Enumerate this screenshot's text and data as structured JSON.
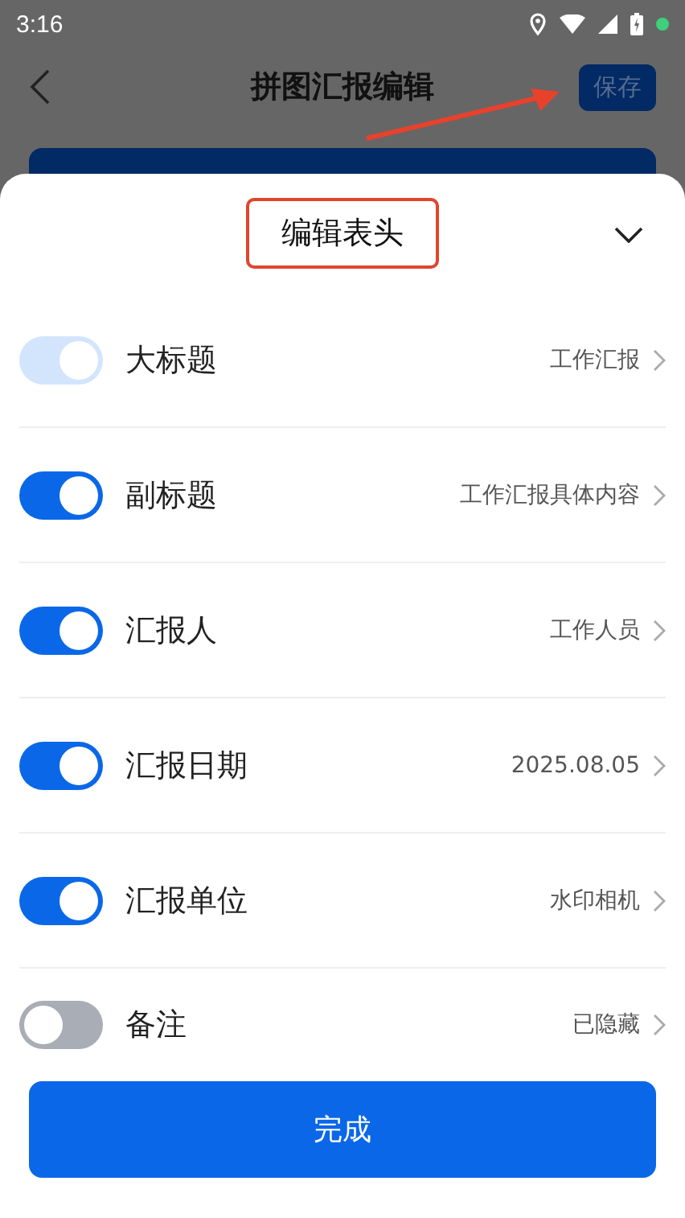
{
  "status_bar": {
    "time": "3:16"
  },
  "header": {
    "title": "拼图汇报编辑",
    "save_button": "保存"
  },
  "sheet": {
    "title": "编辑表头",
    "items": [
      {
        "label": "大标题",
        "value": "工作汇报",
        "on": true,
        "disabled": true
      },
      {
        "label": "副标题",
        "value": "工作汇报具体内容",
        "on": true,
        "disabled": false
      },
      {
        "label": "汇报人",
        "value": "工作人员",
        "on": true,
        "disabled": false
      },
      {
        "label": "汇报日期",
        "value": "2025.08.05",
        "on": true,
        "disabled": false
      },
      {
        "label": "汇报单位",
        "value": "水印相机",
        "on": true,
        "disabled": false
      },
      {
        "label": "备注",
        "value": "已隐藏",
        "on": false,
        "disabled": false
      }
    ],
    "done_button": "完成"
  }
}
